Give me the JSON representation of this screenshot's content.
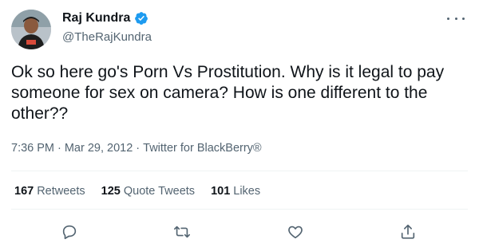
{
  "author": {
    "display_name": "Raj Kundra",
    "handle": "@TheRajKundra"
  },
  "tweet": {
    "text": "Ok so here go's Porn Vs Prostitution. Why is it legal to pay someone for sex on camera? How is one different to the other??",
    "time": "7:36 PM",
    "sep1": "·",
    "date": "Mar 29, 2012",
    "sep2": "·",
    "client": "Twitter for BlackBerry®"
  },
  "stats": {
    "retweets_count": "167",
    "retweets_label": "Retweets",
    "quotes_count": "125",
    "quotes_label": "Quote Tweets",
    "likes_count": "101",
    "likes_label": "Likes"
  },
  "icons": {
    "verified": "verified-badge-icon",
    "reply": "reply-icon",
    "retweet": "retweet-icon",
    "like": "heart-icon",
    "share": "share-icon",
    "more": "more-options-icon"
  },
  "colors": {
    "verified": "#1d9bf0",
    "text": "#0f1419",
    "secondary": "#536471"
  }
}
